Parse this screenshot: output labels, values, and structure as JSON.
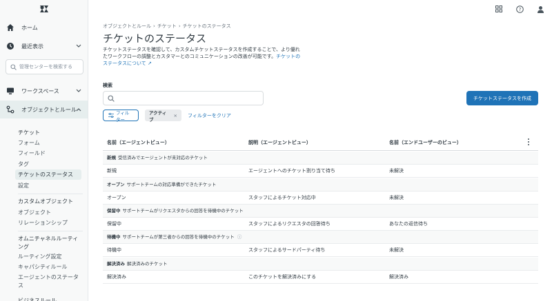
{
  "sidebar": {
    "nav": [
      {
        "label": "ホーム",
        "icon": "home-icon"
      },
      {
        "label": "最近表示",
        "icon": "clock-icon"
      }
    ],
    "search_placeholder": "管理センターを検索する",
    "sections": [
      {
        "label": "ワークスペース",
        "icon": "monitor-icon"
      },
      {
        "label": "オブジェクトとルール",
        "icon": "objects-icon"
      }
    ],
    "tickets_group": {
      "header": "チケット",
      "items": [
        "フォーム",
        "フィールド",
        "タグ",
        "チケットのステータス",
        "設定"
      ]
    },
    "custom_objects_group": {
      "header": "カスタムオブジェクト",
      "items": [
        "オブジェクト",
        "リレーションシップ"
      ]
    },
    "omnichannel_group": {
      "header": "オムニチャネルルーティング",
      "items": [
        "ルーティング設定",
        "キャパシティルール",
        "エージェントのステータス"
      ]
    },
    "business_rules_header": "ビジネスルール"
  },
  "breadcrumb": [
    "オブジェクトとルール",
    "チケット",
    "チケットのステータス"
  ],
  "page_title": "チケットのステータス",
  "description": "チケットステータスを確認して、カスタムチケットステータスを作成することで、より優れたワークフローの調整とカスタマーとのコミュニケーションの改善が可能です。",
  "description_link": "チケットのステータスについて",
  "search": {
    "label": "検索",
    "placeholder": ""
  },
  "create_button": "チケットステータスを作成",
  "filter_button": "フィルター",
  "active_tag": "アクティブ",
  "clear_filters": "フィルターをクリア",
  "table": {
    "headers": [
      "名前（エージェントビュー）",
      "説明（エージェントビュー）",
      "名前（エンドユーザーのビュー）"
    ],
    "groups": [
      {
        "name": "新規",
        "desc": "受信済みでエージェントが未対応のチケット",
        "row": [
          "新規",
          "エージェントへのチケット割り当て待ち",
          "未解決"
        ]
      },
      {
        "name": "オープン",
        "desc": "サポートチームの対応準備ができたチケット",
        "row": [
          "オープン",
          "スタッフによるチケット対応中",
          "未解決"
        ]
      },
      {
        "name": "保留中",
        "desc": "サポートチームがリクエスタからの回答を待機中のチケット",
        "row": [
          "保留中",
          "スタッフによるリクエスタの回答待ち",
          "あなたの返信待ち"
        ]
      },
      {
        "name": "待機中",
        "desc": "サポートチームが第三者からの回答を待機中のチケット",
        "row": [
          "待機中",
          "スタッフによるサードパーティ待ち",
          "未解決"
        ]
      },
      {
        "name": "解決済み",
        "desc": "解決済みのチケット",
        "row": [
          "解決済み",
          "このチケットを解決済みにする",
          "解決済み"
        ]
      }
    ]
  },
  "colors": {
    "accent": "#1f73b7",
    "sidebar_bg": "#f8f9f9",
    "selected_bg": "#e6eeee"
  }
}
